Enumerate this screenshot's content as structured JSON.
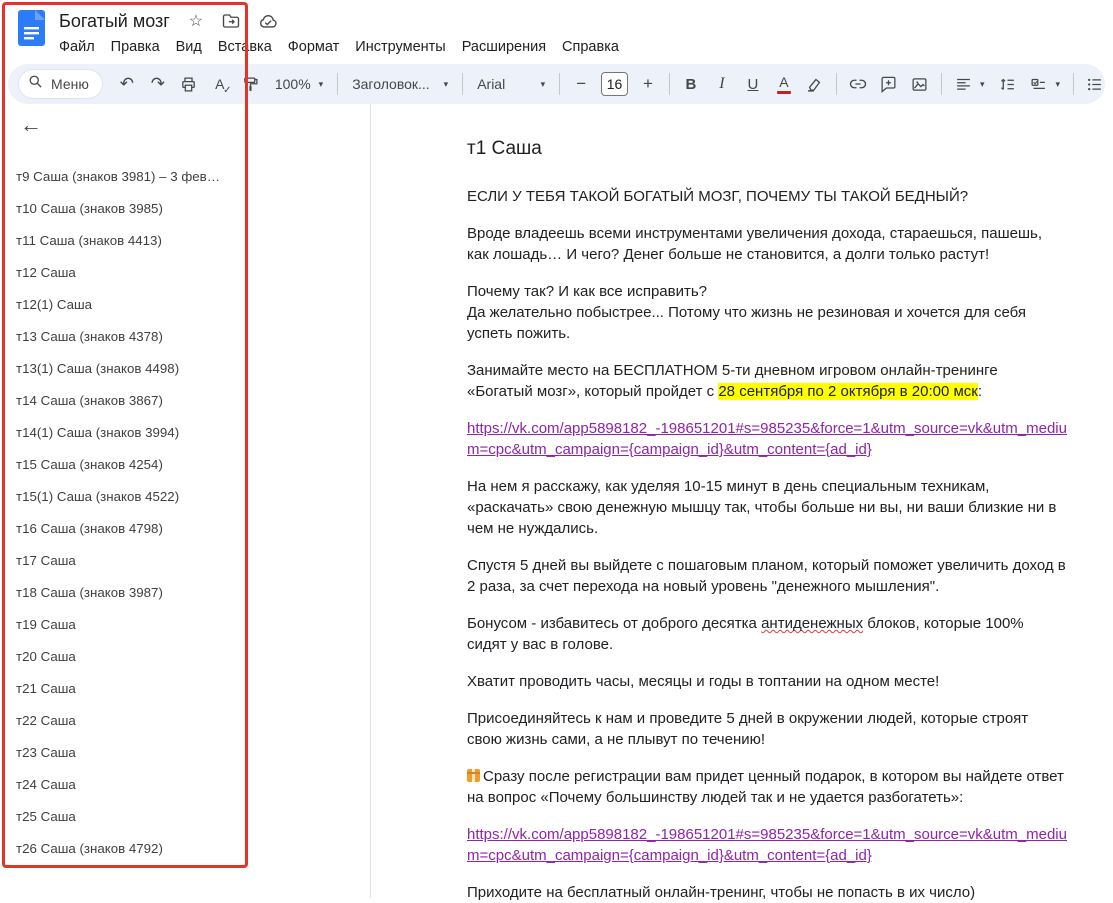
{
  "colors": {
    "annotation_red": "#e5332a",
    "highlight_yellow": "#ffff00",
    "link_purple": "#8e24aa",
    "toolbar_bg": "#edf2fa",
    "docs_icon_blue": "#2b7cf6",
    "text_color_bar": "#c5221f"
  },
  "header": {
    "title": "Богатый мозг",
    "star_icon": "☆",
    "menus": [
      "Файл",
      "Правка",
      "Вид",
      "Вставка",
      "Формат",
      "Инструменты",
      "Расширения",
      "Справка"
    ]
  },
  "toolbar": {
    "search_label": "Меню",
    "zoom": "100%",
    "paragraph_style": "Заголовок...",
    "font": "Arial",
    "font_size": "16",
    "glyphs": {
      "undo": "↶",
      "redo": "↷",
      "caret": "▾",
      "minus": "−",
      "plus": "+",
      "bold": "B",
      "italic": "I",
      "underline": "U",
      "text_color": "A",
      "spellcheck_letter": "A",
      "spellcheck_check": "✓"
    }
  },
  "outline": {
    "back_icon": "←",
    "items": [
      "т9 Саша (знаков 3981) – 3 фев…",
      "т10 Саша (знаков 3985)",
      "т11 Саша (знаков 4413)",
      "т12 Саша",
      "т12(1) Саша",
      "т13 Саша (знаков 4378)",
      "т13(1) Саша (знаков 4498)",
      "т14 Саша (знаков 3867)",
      "т14(1) Саша (знаков 3994)",
      "т15 Саша (знаков 4254)",
      "т15(1) Саша (знаков 4522)",
      "т16 Саша (знаков 4798)",
      "т17 Саша",
      "т18 Саша (знаков 3987)",
      "т19 Саша",
      "т20 Саша",
      "т21 Саша",
      "т22 Саша",
      "т23 Саша",
      "т24 Саша",
      "т25 Саша",
      "т26 Саша (знаков 4792)"
    ]
  },
  "doc": {
    "heading": "т1 Саша",
    "p1": "ЕСЛИ У ТЕБЯ ТАКОЙ БОГАТЫЙ МОЗГ, ПОЧЕМУ ТЫ ТАКОЙ БЕДНЫЙ?",
    "p2": "Вроде владеешь всеми инструментами увеличения дохода, стараешься, пашешь, как лошадь… И чего? Денег больше не становится, а долги только растут!",
    "p3a": "Почему так? И как все исправить?",
    "p3b": "Да желательно побыстрее... Потому что жизнь не резиновая и хочется для себя успеть пожить.",
    "p4_pre": "Занимайте место на БЕСПЛАТНОМ 5-ти дневном игровом онлайн-тренинге «Богатый мозг», который пройдет с ",
    "p4_highlight": "28 сентября по 2 октября в 20:00 мск",
    "p4_colon": ":",
    "link_url": "https://vk.com/app5898182_-198651201#s=985235&force=1&utm_source=vk&utm_medium=cpc&utm_campaign={campaign_id}&utm_content={ad_id}",
    "p5": "На нем я расскажу, как уделяя 10-15 минут в день специальным техникам, «раскачать» свою денежную мышцу так, чтобы больше ни вы, ни ваши близкие ни в чем не нуждались.",
    "p6": "Спустя 5 дней вы выйдете с пошаговым планом, который поможет увеличить доход в 2 раза, за счет перехода на новый уровень \"денежного мышления\".",
    "p7_pre": "Бонусом - избавитесь от доброго десятка ",
    "p7_word": "антиденежных",
    "p7_post": " блоков, которые 100% сидят у вас в голове.",
    "p8": "Хватит проводить часы, месяцы и годы в топтании на одном месте!",
    "p9": "Присоединяйтесь к нам и проведите 5 дней в окружении людей, которые строят свою жизнь сами, а не плывут по течению!",
    "p10_emoji": "🎁",
    "p10_text": "Сразу после регистрации вам придет ценный подарок, в котором вы найдете ответ на вопрос «Почему большинству людей так и не удается разбогатеть»:",
    "p11": "Приходите на бесплатный онлайн-тренинг, чтобы не попасть в их число)"
  }
}
